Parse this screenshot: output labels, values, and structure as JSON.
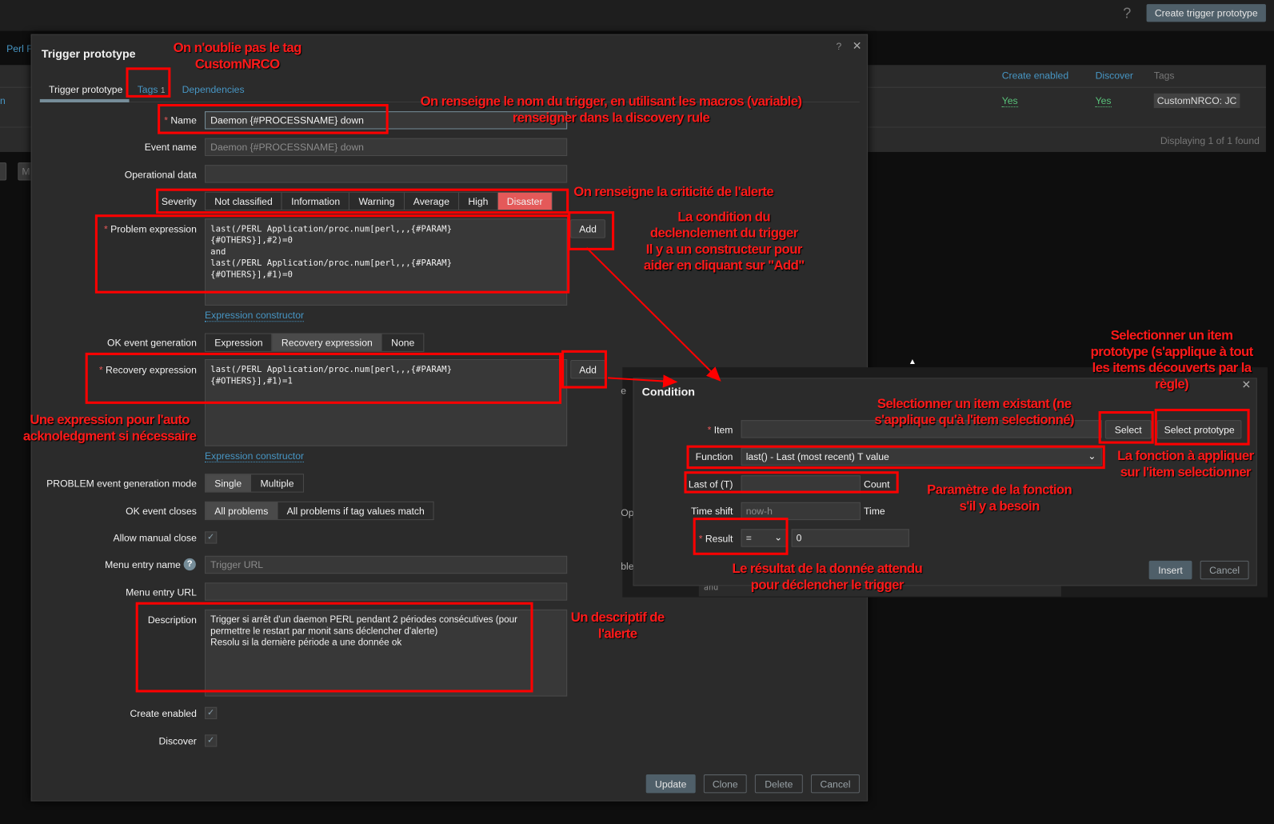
{
  "topbar": {
    "help": "?",
    "create_button": "Create trigger prototype"
  },
  "breadcrumb": "Perl F",
  "list": {
    "headers": [
      "Create enabled",
      "Discover",
      "Tags"
    ],
    "row": {
      "create_enabled": "Yes",
      "discover": "Yes",
      "tag": "CustomNRCO: JC",
      "left_fragment": "n"
    },
    "footer": "Displaying 1 of 1 found",
    "left_button_fragment": "M"
  },
  "modal": {
    "title": "Trigger prototype",
    "help": "?",
    "close": "✕",
    "tabs": [
      {
        "label": "Trigger prototype"
      },
      {
        "label": "Tags",
        "count": "1"
      },
      {
        "label": "Dependencies"
      }
    ],
    "fields": {
      "name_label": "Name",
      "name_value": "Daemon {#PROCESSNAME} down",
      "event_name_label": "Event name",
      "event_name_placeholder": "Daemon {#PROCESSNAME} down",
      "operational_data_label": "Operational data",
      "severity_label": "Severity",
      "severities": [
        "Not classified",
        "Information",
        "Warning",
        "Average",
        "High",
        "Disaster"
      ],
      "severity_selected": "Disaster",
      "problem_expression_label": "Problem expression",
      "problem_expression": "last(/PERL Application/proc.num[perl,,,{#PARAM}\n{#OTHERS}],#2)=0\nand\nlast(/PERL Application/proc.num[perl,,,{#PARAM}\n{#OTHERS}],#1)=0",
      "add_label": "Add",
      "expression_constructor": "Expression constructor",
      "ok_event_generation_label": "OK event generation",
      "ok_event_options": [
        "Expression",
        "Recovery expression",
        "None"
      ],
      "ok_event_selected": "Recovery expression",
      "recovery_expression_label": "Recovery expression",
      "recovery_expression": "last(/PERL Application/proc.num[perl,,,{#PARAM}\n{#OTHERS}],#1)=1",
      "problem_mode_label": "PROBLEM event generation mode",
      "problem_mode_options": [
        "Single",
        "Multiple"
      ],
      "problem_mode_selected": "Single",
      "ok_closes_label": "OK event closes",
      "ok_closes_options": [
        "All problems",
        "All problems if tag values match"
      ],
      "ok_closes_selected": "All problems",
      "allow_manual_close_label": "Allow manual close",
      "menu_entry_name_label": "Menu entry name",
      "menu_entry_name_placeholder": "Trigger URL",
      "menu_entry_url_label": "Menu entry URL",
      "description_label": "Description",
      "description": "Trigger si arrêt d'un daemon PERL pendant 2 périodes consécutives (pour\npermettre le restart par monit sans déclencher d'alerte)\nResolu si la dernière période a une donnée ok",
      "create_enabled_label": "Create enabled",
      "discover_label": "Discover"
    },
    "buttons": {
      "update": "Update",
      "clone": "Clone",
      "delete": "Delete",
      "cancel": "Cancel"
    }
  },
  "behind": {
    "f1": "e",
    "f2": "Op",
    "f3": "ble",
    "f4": "and"
  },
  "condition": {
    "title": "Condition",
    "close": "✕",
    "item_label": "Item",
    "select": "Select",
    "select_prototype": "Select prototype",
    "function_label": "Function",
    "function_value": "last() - Last (most recent) T value",
    "last_of_label": "Last of (T)",
    "last_of_unit": "Count",
    "time_shift_label": "Time shift",
    "time_shift_placeholder": "now-h",
    "time_shift_unit": "Time",
    "result_label": "Result",
    "result_operator": "=",
    "result_value": "0",
    "insert": "Insert",
    "cancel": "Cancel"
  },
  "annotations": {
    "tag": [
      "On n'oublie pas le tag",
      "CustomNRCO"
    ],
    "name": [
      "On renseigne le nom du trigger, en utilisant les macros (variable)",
      "renseigner dans la discovery rule"
    ],
    "severity": "On renseigne la criticité de l'alerte",
    "condition": [
      "La condition du",
      "declenclement du trigger",
      "Il y a un constructeur pour",
      "aider en cliquant sur \"Add\""
    ],
    "prototype": [
      "Selectionner un item",
      "prototype (s'applique à tout",
      "les items découverts par la",
      "règle)"
    ],
    "existing": [
      "Selectionner un item existant (ne",
      "s'applique qu'à l'item selectionné)"
    ],
    "function": [
      "La fonction à appliquer",
      "sur l'item selectionner"
    ],
    "param": [
      "Paramètre de la fonction",
      "s'il y a besoin"
    ],
    "result": [
      "Le résultat de la donnée attendu",
      "pour déclencher le trigger"
    ],
    "description": [
      "Un descriptif de",
      "l'alerte"
    ],
    "recovery": [
      "Une expression pour l'auto",
      "acknoledgment si nécessaire"
    ]
  }
}
